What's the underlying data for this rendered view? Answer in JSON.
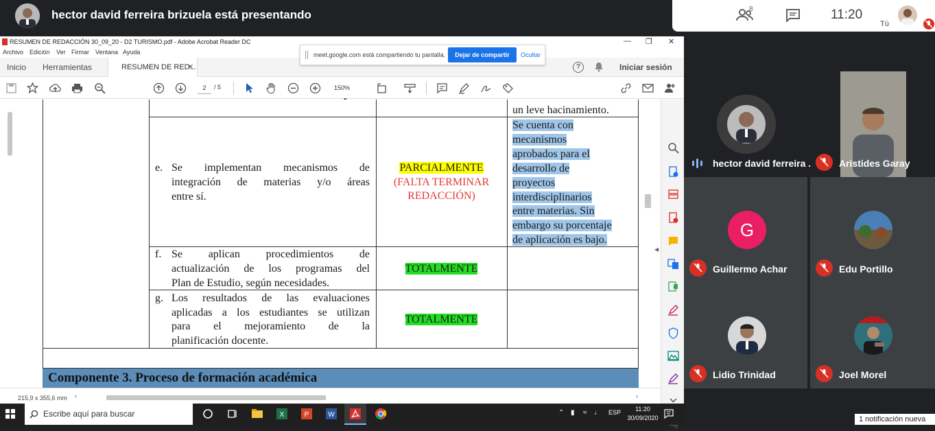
{
  "meet": {
    "presenter_title": "hector david ferreira brizuela está presentando",
    "people_count": "8",
    "time": "11:20",
    "you_label": "Tú"
  },
  "acrobat": {
    "window_title": "RESUMEN DE REDACCIÓN 30_09_20 - D2 TURISMO.pdf - Adobe Acrobat Reader DC",
    "menu": [
      "Archivo",
      "Edición",
      "Ver",
      "Firmar",
      "Ventana",
      "Ayuda"
    ],
    "tabs": {
      "home": "Inicio",
      "tools": "Herramientas",
      "doc": "RESUMEN DE RED..."
    },
    "login": "Iniciar sesión",
    "page_current": "2",
    "page_total": "/ 5",
    "zoom": "150%",
    "status_size": "215,9 x 355,6 mm"
  },
  "share_bar": {
    "text": "meet.google.com está compartiendo tu pantalla.",
    "stop": "Dejar de compartir",
    "hide": "Ocultar"
  },
  "document": {
    "top_right": "un leve hacinamiento.",
    "row_e": {
      "letter": "e.",
      "lines": [
        "Se implementan mecanismos de",
        "integración de materias y/o áreas",
        "entre sí."
      ],
      "status_1": "PARCIALMENTE",
      "status_2": "(FALTA TERMINAR",
      "status_3": "REDACCIÓN)",
      "note": [
        "Se cuenta con",
        "mecanismos",
        "aprobados para el",
        "desarrollo de",
        "proyectos",
        "interdisciplinarios",
        "entre materias. Sin",
        "embargo su porcentaje",
        "de aplicación es bajo."
      ]
    },
    "row_f": {
      "letter": "f.",
      "lines": [
        "Se aplican procedimientos de",
        "actualización de los programas del",
        "Plan de Estudio, según necesidades."
      ],
      "status": "TOTALMENTE"
    },
    "row_g": {
      "letter": "g.",
      "lines": [
        "Los resultados de las evaluaciones",
        "aplicadas a los estudiantes se utilizan",
        "para el mejoramiento de la",
        "planificación docente."
      ],
      "status": "TOTALMENTE"
    },
    "component_header": "Componente 3. Proceso de formación académica"
  },
  "participants": [
    {
      "name": "hector david ferreira ...",
      "initial": ""
    },
    {
      "name": "Aristides Garay",
      "initial": ""
    },
    {
      "name": "Guillermo Achar",
      "initial": "G"
    },
    {
      "name": "Edu Portillo",
      "initial": ""
    },
    {
      "name": "Lidio Trinidad",
      "initial": ""
    },
    {
      "name": "Joel Morel",
      "initial": ""
    }
  ],
  "taskbar": {
    "search": "Escribe aquí para buscar",
    "lang": "ESP",
    "time": "11:20",
    "date": "30/09/2020",
    "notification": "1 notificación nueva"
  },
  "colors": {
    "meet_bg": "#202124",
    "tile_bg": "#3c4043",
    "mic_off": "#d93025",
    "share_blue": "#1a73e8",
    "component_header": "#5b8db8",
    "guillermo_avatar": "#e91e63"
  }
}
